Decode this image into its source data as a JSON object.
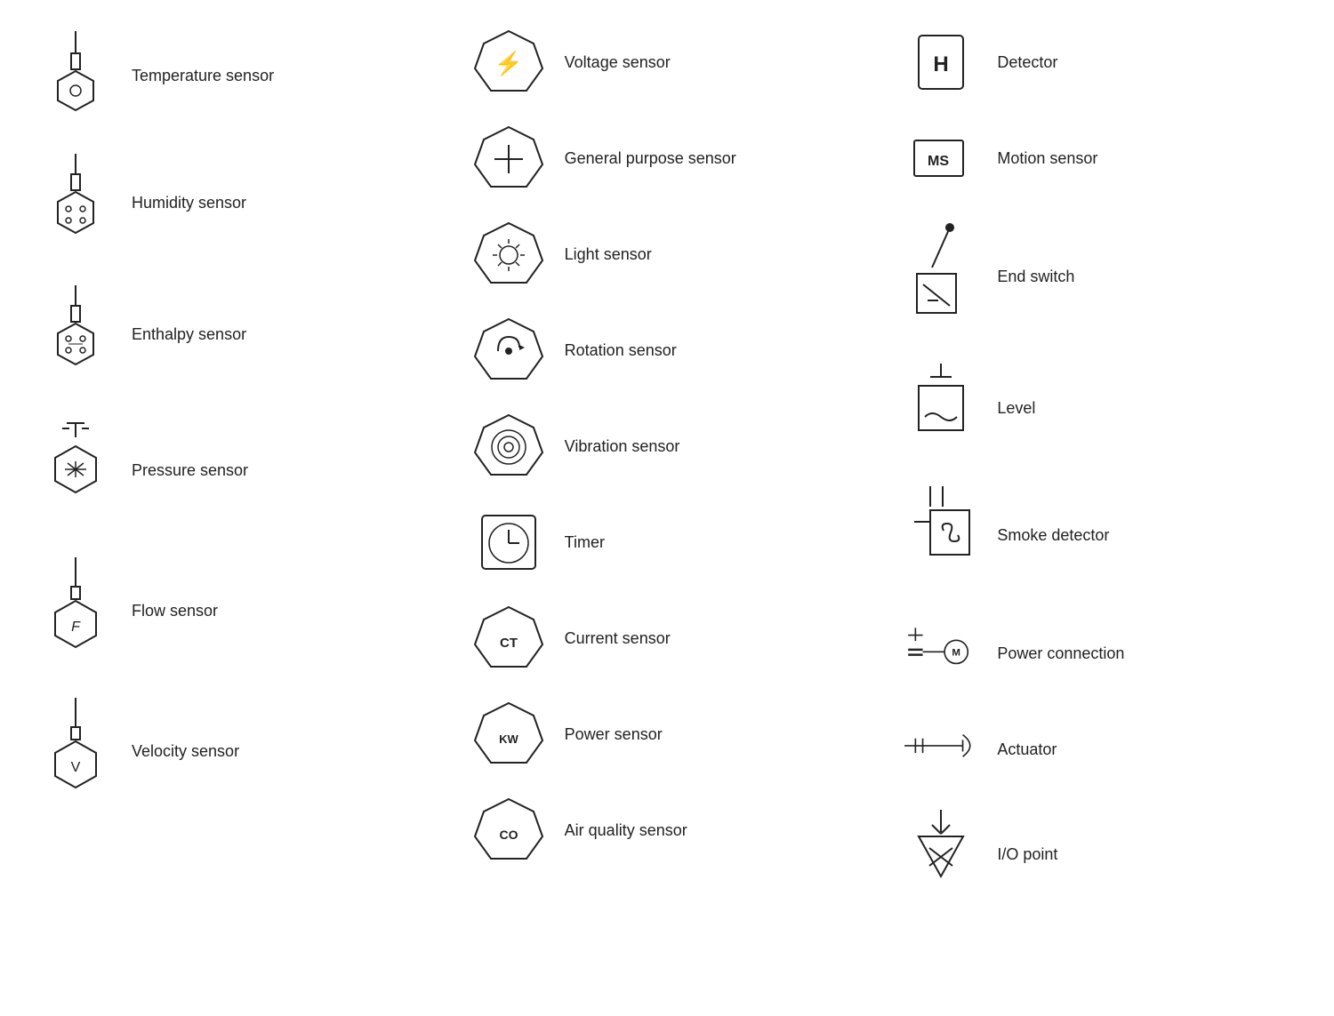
{
  "symbols": {
    "col1": [
      {
        "name": "temperature-sensor",
        "label": "Temperature sensor"
      },
      {
        "name": "humidity-sensor",
        "label": "Humidity sensor"
      },
      {
        "name": "enthalpy-sensor",
        "label": "Enthalpy sensor"
      },
      {
        "name": "pressure-sensor",
        "label": "Pressure sensor"
      },
      {
        "name": "flow-sensor",
        "label": "Flow sensor"
      },
      {
        "name": "velocity-sensor",
        "label": "Velocity sensor"
      }
    ],
    "col2": [
      {
        "name": "voltage-sensor",
        "label": "Voltage sensor"
      },
      {
        "name": "general-purpose-sensor",
        "label": "General purpose sensor"
      },
      {
        "name": "light-sensor",
        "label": "Light sensor"
      },
      {
        "name": "rotation-sensor",
        "label": "Rotation sensor"
      },
      {
        "name": "vibration-sensor",
        "label": "Vibration sensor"
      },
      {
        "name": "timer",
        "label": "Timer"
      },
      {
        "name": "current-sensor",
        "label": "Current sensor"
      },
      {
        "name": "power-sensor",
        "label": "Power sensor"
      },
      {
        "name": "air-quality-sensor",
        "label": "Air quality sensor"
      }
    ],
    "col3": [
      {
        "name": "detector",
        "label": "Detector"
      },
      {
        "name": "motion-sensor",
        "label": "Motion sensor"
      },
      {
        "name": "end-switch",
        "label": "End switch"
      },
      {
        "name": "level",
        "label": "Level"
      },
      {
        "name": "smoke-detector",
        "label": "Smoke detector"
      },
      {
        "name": "power-connection",
        "label": "Power connection"
      },
      {
        "name": "actuator",
        "label": "Actuator"
      },
      {
        "name": "io-point",
        "label": "I/O point"
      }
    ]
  }
}
